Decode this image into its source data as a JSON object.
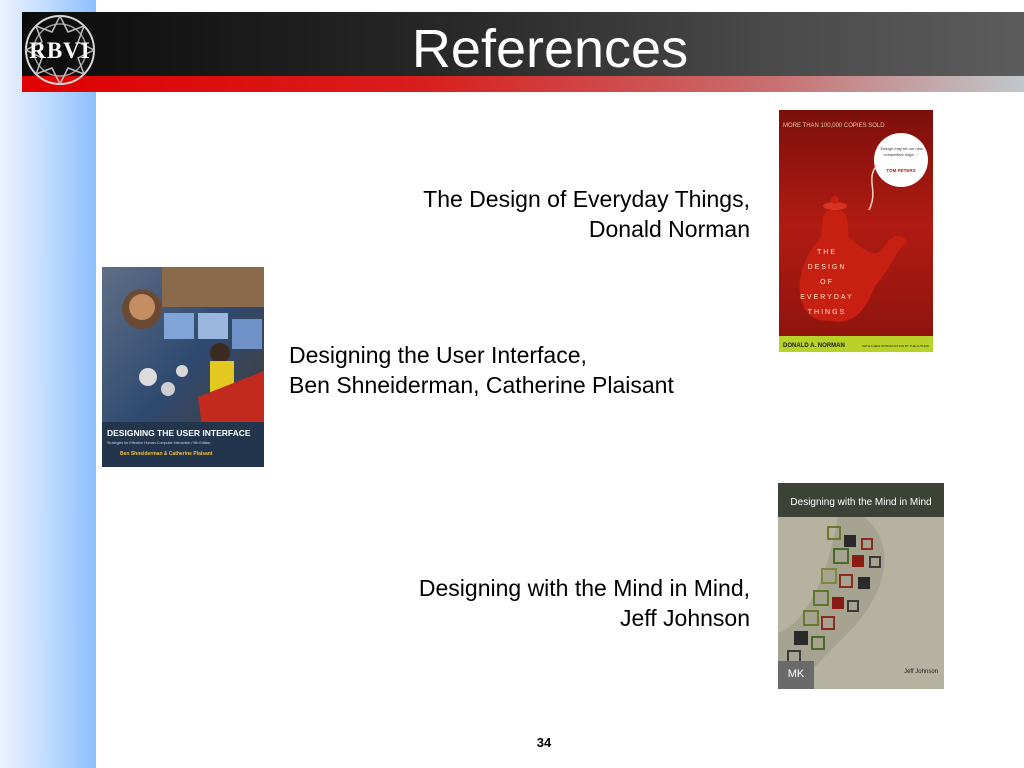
{
  "slide": {
    "title": "References",
    "page_number": "34"
  },
  "logo": {
    "text": "RBVI"
  },
  "references": [
    {
      "line1": "The Design of Everyday Things,",
      "line2": "Donald Norman",
      "cover": {
        "top_banner": "MORE THAN 100,000 COPIES SOLD",
        "quote": "\"Design may be our new competitive edge. This book is a joy—fun and of the utmost importance.\"",
        "quote_author": "TOM PETERS",
        "title_lines": [
          "THE",
          "DESIGN",
          "OF",
          "EVERYDAY",
          "THINGS"
        ],
        "author": "DONALD A. NORMAN",
        "footer_note": "WITH A NEW INTRODUCTION BY THE AUTHOR"
      }
    },
    {
      "line1": "Designing the User Interface,",
      "line2": "Ben Shneiderman, Catherine Plaisant",
      "cover": {
        "title": "DESIGNING THE USER INTERFACE",
        "subtitle": "Strategies for Effective Human-Computer Interaction / 5th Edition",
        "authors": "Ben Shneiderman & Catherine Plaisant"
      }
    },
    {
      "line1": "Designing with the Mind in Mind,",
      "line2": "Jeff Johnson",
      "cover": {
        "title": "Designing with the Mind in Mind",
        "publisher": "MK",
        "author": "Jeff Johnson"
      }
    }
  ],
  "colors": {
    "title_bar": "#1a1a1a",
    "red_accent": "#e00000",
    "side_strip": "#8cc0ff",
    "cover1_bg": "#a41a12",
    "cover1_green": "#b8d22a"
  }
}
